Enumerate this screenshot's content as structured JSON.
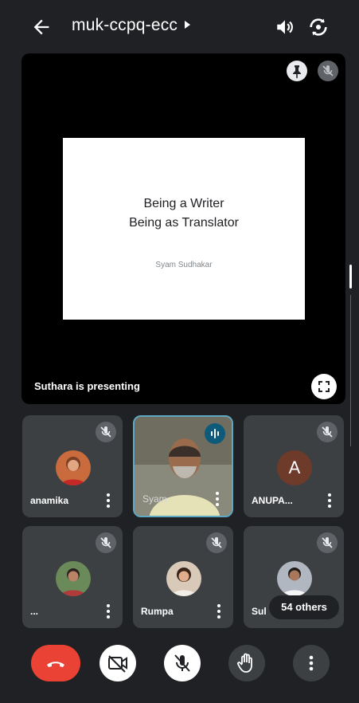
{
  "header": {
    "meeting_code": "muk-ccpq-ecc",
    "back_icon": "arrow-left-icon",
    "speaker_icon": "speaker-icon",
    "switch_camera_icon": "switch-camera-icon"
  },
  "presentation": {
    "slide_title_line1": "Being a Writer",
    "slide_title_line2": "Being as Translator",
    "slide_author": "Syam Sudhakar",
    "presenting_label": "Suthara is presenting",
    "pin_icon": "pin-icon",
    "fullscreen_icon": "fullscreen-icon"
  },
  "participants": [
    {
      "name": "anamika",
      "muted": true,
      "avatar": "photo"
    },
    {
      "name": "Syam",
      "muted": false,
      "video": true,
      "speaking": true
    },
    {
      "name": "ANUPA...",
      "muted": true,
      "avatar_letter": "A"
    },
    {
      "name": "...",
      "muted": true,
      "avatar": "photo"
    },
    {
      "name": "Rumpa",
      "muted": true,
      "avatar": "photo"
    },
    {
      "name": "Sul",
      "muted": true,
      "avatar": "photo"
    }
  ],
  "others_badge": "54 others",
  "controls": {
    "end_call_icon": "end-call-icon",
    "camera_off_icon": "camera-off-icon",
    "mic_off_icon": "mic-off-icon",
    "raise_hand_icon": "raise-hand-icon",
    "more_icon": "more-vertical-icon",
    "end_call_color": "#ea4335"
  }
}
